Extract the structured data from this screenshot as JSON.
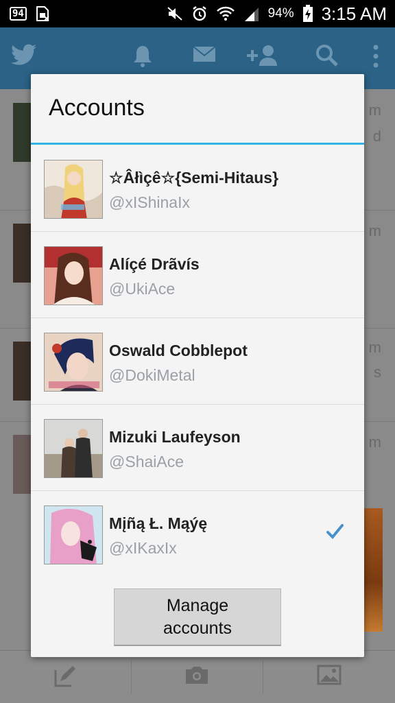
{
  "status_bar": {
    "notification_count": "94",
    "battery_percent": "94%",
    "time": "3:15 AM",
    "icons": [
      "notification-count-icon",
      "sim-card-icon",
      "mute-icon",
      "alarm-icon",
      "wifi-icon",
      "signal-icon",
      "battery-charging-icon"
    ]
  },
  "app": {
    "toolbar_icons": [
      "twitter-bird-icon",
      "notifications-bell-icon",
      "messages-envelope-icon",
      "add-user-icon",
      "search-icon",
      "overflow-menu-icon"
    ],
    "feed_meta": [
      "m",
      "d",
      "m",
      "m",
      "s",
      "m"
    ],
    "bottom_icons": [
      "compose-tweet-icon",
      "camera-icon",
      "image-gallery-icon"
    ],
    "brand_color": "#55acee"
  },
  "dialog": {
    "title": "Accounts",
    "accent_color": "#33b5e5",
    "accounts": [
      {
        "name": "☆Âłìçê☆{Semi-Hitaus}",
        "handle": "@xIShinaIx",
        "selected": false
      },
      {
        "name": "Alíçé Drãvís",
        "handle": "@UkiAce",
        "selected": false
      },
      {
        "name": "Oswald Cobblepot",
        "handle": "@DokiMetal",
        "selected": false
      },
      {
        "name": "Mizuki Laufeyson",
        "handle": "@ShaiAce",
        "selected": false
      },
      {
        "name": "Mįñą Ł. Mąýę",
        "handle": "@xIKaxIx",
        "selected": true
      }
    ],
    "manage_button": "Manage accounts"
  }
}
